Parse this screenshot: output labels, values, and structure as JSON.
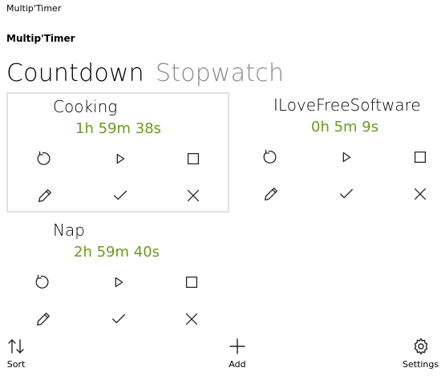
{
  "window": {
    "title": "Multip'Timer"
  },
  "app": {
    "title": "Multip'Timer"
  },
  "tabs": [
    {
      "label": "Countdown",
      "active": true
    },
    {
      "label": "Stopwatch",
      "active": false
    }
  ],
  "timers": [
    {
      "name": "Cooking",
      "time": "1h 59m 38s",
      "selected": true
    },
    {
      "name": "ILoveFreeSoftware",
      "time": "0h 5m 9s",
      "selected": false
    },
    {
      "name": "Nap",
      "time": "2h 59m 40s",
      "selected": false
    }
  ],
  "timer_actions": [
    "reset-icon",
    "play-icon",
    "stop-icon",
    "edit-icon",
    "check-icon",
    "delete-icon"
  ],
  "bottom_bar": {
    "sort_label": "Sort",
    "add_label": "Add",
    "settings_label": "Settings"
  },
  "colors": {
    "time_text": "#6b9b1f",
    "selected_border": "#e1e1e1",
    "inactive_tab": "#8a8a8a"
  }
}
